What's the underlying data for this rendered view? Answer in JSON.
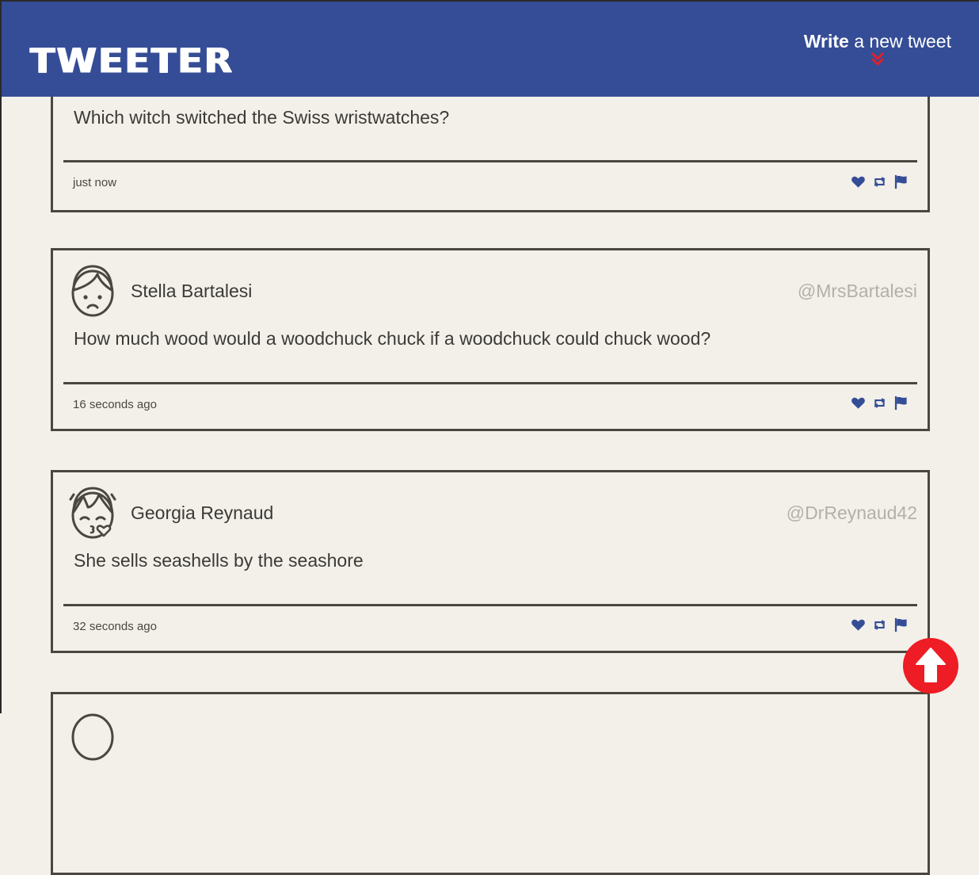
{
  "app": {
    "logo": "TWEETER"
  },
  "compose": {
    "bold": "Write",
    "rest": " a new tweet",
    "icon": "double-chevron-down-icon",
    "accent": "#e0202a"
  },
  "colors": {
    "header": "#354d96",
    "background": "#f3f0ea",
    "border": "#4a4740",
    "icon": "#354d96",
    "scroll_button": "#ee1c24"
  },
  "tweets": [
    {
      "name": "",
      "handle": "",
      "text": "Which witch switched the Swiss wristwatches?",
      "time": "just now"
    },
    {
      "name": "Stella Bartalesi",
      "handle": "@MrsBartalesi",
      "text": "How much wood would a woodchuck chuck if a woodchuck could chuck wood?",
      "time": "16 seconds ago",
      "avatar": "sad-face-avatar-icon"
    },
    {
      "name": "Georgia Reynaud",
      "handle": "@DrReynaud42",
      "text": "She sells seashells by the seashore",
      "time": "32 seconds ago",
      "avatar": "kissing-face-avatar-icon"
    },
    {
      "name": "",
      "handle": "",
      "text": "",
      "time": "",
      "avatar": "avatar-icon"
    }
  ],
  "actions": [
    "heart-icon",
    "retweet-icon",
    "flag-icon"
  ],
  "scroll_top": {
    "icon": "arrow-up-icon"
  }
}
